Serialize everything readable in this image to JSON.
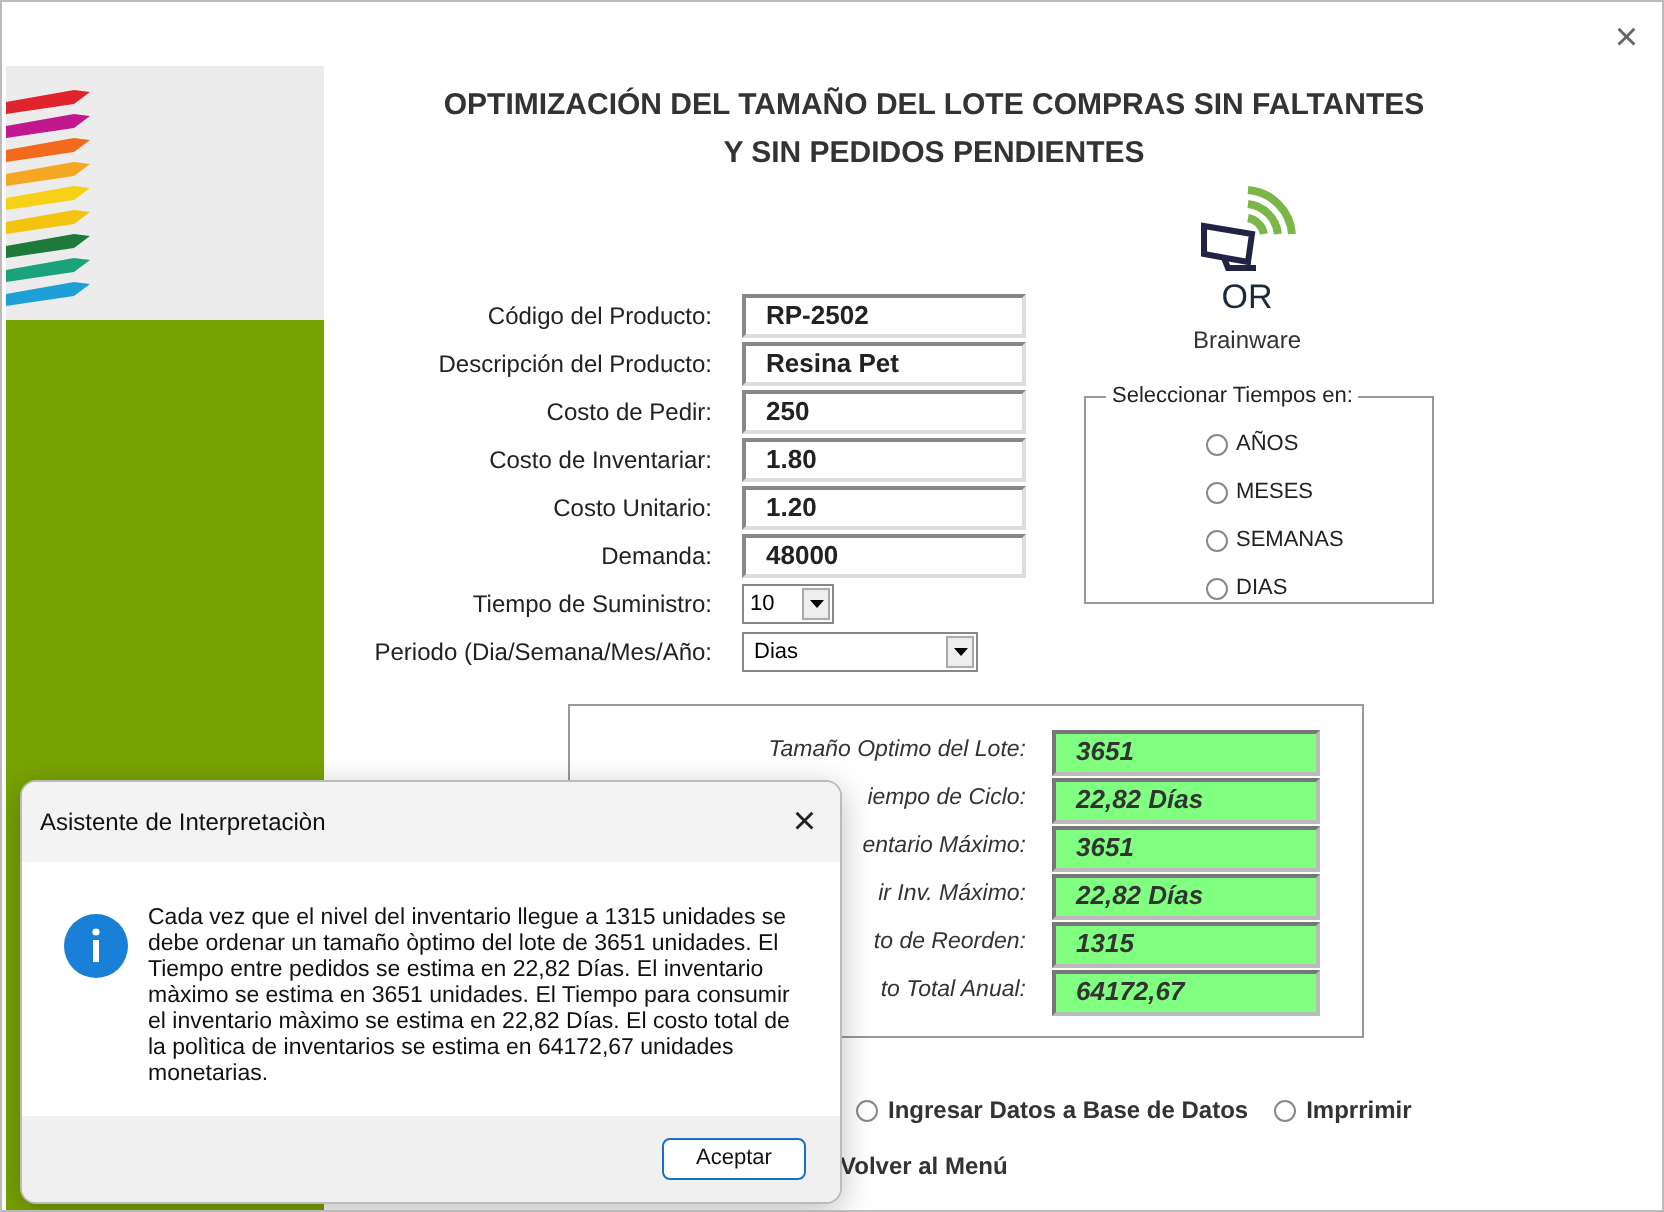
{
  "window": {
    "close": "×"
  },
  "title_lines": [
    "OPTIMIZACIÓN DEL TAMAÑO DEL LOTE COMPRAS SIN FALTANTES",
    "Y SIN  PEDIDOS PENDIENTES"
  ],
  "form": [
    {
      "kind": "text",
      "label": "Código del Producto:",
      "value": "RP-2502"
    },
    {
      "kind": "text",
      "label": "Descripción del Producto:",
      "value": "Resina Pet"
    },
    {
      "kind": "text",
      "label": "Costo de Pedir:",
      "value": "250"
    },
    {
      "kind": "text",
      "label": "Costo de Inventariar:",
      "value": "1.80"
    },
    {
      "kind": "text",
      "label": "Costo Unitario:",
      "value": "1.20"
    },
    {
      "kind": "text",
      "label": "Demanda:",
      "value": "48000"
    },
    {
      "kind": "small_select",
      "label": "Tiempo de Suministro:",
      "value": "10"
    },
    {
      "kind": "select",
      "label": "Periodo (Dia/Semana/Mes/Año:",
      "value": "Dias"
    }
  ],
  "logo": {
    "mark": "OR",
    "name": "Brainware"
  },
  "time_group": {
    "legend": "Seleccionar Tiempos en:",
    "options": [
      {
        "label": "AÑOS",
        "selected": false
      },
      {
        "label": "MESES",
        "selected": false
      },
      {
        "label": "SEMANAS",
        "selected": false
      },
      {
        "label": "DIAS",
        "selected": false
      }
    ]
  },
  "results": [
    {
      "label": "Tamaño Optimo del Lote:",
      "value": "3651"
    },
    {
      "label": "iempo de Ciclo:",
      "value": "22,82 Días"
    },
    {
      "label": "entario Máximo:",
      "value": "3651"
    },
    {
      "label": "ir  Inv. Máximo:",
      "value": "22,82 Días"
    },
    {
      "label": "to de Reorden:",
      "value": "1315"
    },
    {
      "label": "to Total Anual:",
      "value": "64172,67"
    }
  ],
  "actions": [
    {
      "kind": "radio",
      "label": "Ingresar Datos a Base de Datos",
      "selected": false
    },
    {
      "kind": "radio",
      "label": "Imprrimir",
      "selected": false
    }
  ],
  "back_option": {
    "label": "Volver al Menú"
  },
  "dialog": {
    "title": "Asistente de Interpretaciòn",
    "close": "×",
    "message": "Cada vez que el nivel del inventario llegue a 1315 unidades se debe ordenar un tamaño òptimo del lote de 3651 unidades. El Tiempo entre pedidos se estima en 22,82 Días. El inventario màximo se estima en 3651 unidades. El Tiempo para consumir el inventario màximo se estima en 22,82 Días. El costo total de la polìtica de inventarios se estima en 64172,67 unidades monetarias.",
    "button": "Aceptar"
  }
}
